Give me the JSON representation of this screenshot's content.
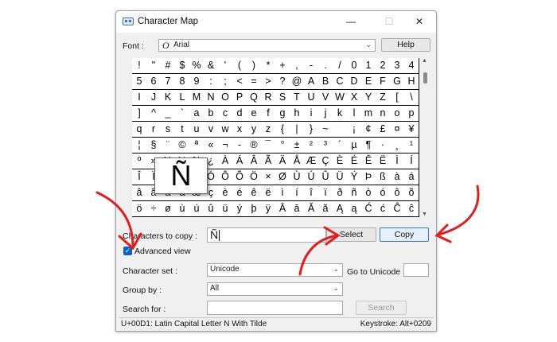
{
  "window": {
    "title": "Character Map",
    "controls": {
      "minimize": "—",
      "maximize": "☐",
      "close": "✕"
    }
  },
  "font": {
    "label": "Font :",
    "value": "Arial",
    "help_button": "Help"
  },
  "grid": {
    "rows": [
      [
        "!",
        "\"",
        "#",
        "$",
        "%",
        "&",
        "'",
        "(",
        ")",
        "*",
        "+",
        ",",
        "-",
        ".",
        "/",
        "0",
        "1",
        "2",
        "3",
        "4"
      ],
      [
        "5",
        "6",
        "7",
        "8",
        "9",
        ":",
        ";",
        "<",
        "=",
        ">",
        "?",
        "@",
        "A",
        "B",
        "C",
        "D",
        "E",
        "F",
        "G",
        "H"
      ],
      [
        "I",
        "J",
        "K",
        "L",
        "M",
        "N",
        "O",
        "P",
        "Q",
        "R",
        "S",
        "T",
        "U",
        "V",
        "W",
        "X",
        "Y",
        "Z",
        "[",
        "\\"
      ],
      [
        "]",
        "^",
        "_",
        "`",
        "a",
        "b",
        "c",
        "d",
        "e",
        "f",
        "g",
        "h",
        "i",
        "j",
        "k",
        "l",
        "m",
        "n",
        "o",
        "p"
      ],
      [
        "q",
        "r",
        "s",
        "t",
        "u",
        "v",
        "w",
        "x",
        "y",
        "z",
        "{",
        "|",
        "}",
        "~",
        " ",
        "¡",
        "¢",
        "£",
        "¤",
        "¥"
      ],
      [
        "¦",
        "§",
        "¨",
        "©",
        "ª",
        "«",
        "¬",
        "-",
        "®",
        "¯",
        "°",
        "±",
        "²",
        "³",
        "´",
        "µ",
        "¶",
        "·",
        "¸",
        "¹"
      ],
      [
        "º",
        "»",
        "¼",
        "½",
        "¾",
        "¿",
        "À",
        "Á",
        "Â",
        "Ã",
        "Ä",
        "Å",
        "Æ",
        "Ç",
        "È",
        "É",
        "Ê",
        "Ë",
        "Ì",
        "Í"
      ],
      [
        "Î",
        "Ï",
        "Ð",
        "Ñ",
        "Ò",
        "Ó",
        "Ô",
        "Õ",
        "Ö",
        "×",
        "Ø",
        "Ù",
        "Ú",
        "Û",
        "Ü",
        "Ý",
        "Þ",
        "ß",
        "à",
        "á"
      ],
      [
        "â",
        "ã",
        "ä",
        "å",
        "æ",
        "ç",
        "è",
        "é",
        "ê",
        "ë",
        "ì",
        "í",
        "î",
        "ï",
        "ð",
        "ñ",
        "ò",
        "ó",
        "ô",
        "õ"
      ],
      [
        "ö",
        "÷",
        "ø",
        "ù",
        "ú",
        "û",
        "ü",
        "ý",
        "þ",
        "ÿ",
        "Ā",
        "ā",
        "Ă",
        "ă",
        "Ą",
        "ą",
        "Ć",
        "ć",
        "Ĉ",
        "ĉ"
      ]
    ],
    "selected_char": "Ñ"
  },
  "copy_row": {
    "label": "Characters to copy :",
    "value": "Ñ",
    "select_button": "Select",
    "copy_button": "Copy"
  },
  "advanced_view": {
    "label": "Advanced view",
    "checked": true
  },
  "character_set": {
    "label": "Character set :",
    "value": "Unicode",
    "goto_label": "Go to Unicode :",
    "goto_value": ""
  },
  "group_by": {
    "label": "Group by :",
    "value": "All"
  },
  "search": {
    "label": "Search for :",
    "value": "",
    "button": "Search"
  },
  "status": {
    "left": "U+00D1: Latin Capital Letter N With Tilde",
    "right": "Keystroke: Alt+0209"
  },
  "colors": {
    "arrows": "#e11d1d",
    "checkbox": "#0a64c8",
    "focus_border": "#3c78c8"
  }
}
